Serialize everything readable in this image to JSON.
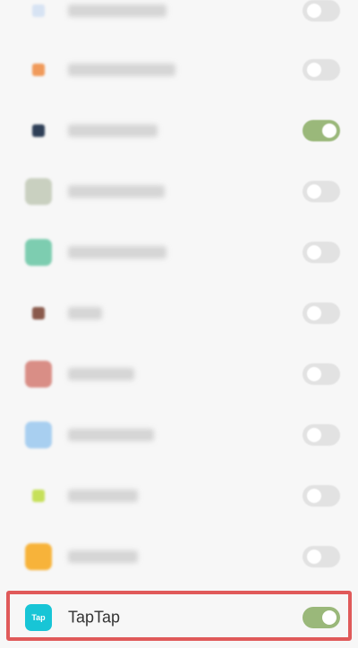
{
  "apps": [
    {
      "name": "",
      "enabled": false,
      "icon_color": "#d7e3f3",
      "icon_small": true
    },
    {
      "name": "",
      "enabled": false,
      "icon_color": "#f09a5b",
      "icon_small": true
    },
    {
      "name": "",
      "enabled": true,
      "icon_color": "#2e3f57",
      "icon_small": true
    },
    {
      "name": "",
      "enabled": false,
      "icon_color": "#c9d0c0",
      "icon_small": false
    },
    {
      "name": "",
      "enabled": false,
      "icon_color": "#7dcdb0",
      "icon_small": false
    },
    {
      "name": "",
      "enabled": false,
      "icon_color": "#8a5a4c",
      "icon_small": true
    },
    {
      "name": "",
      "enabled": false,
      "icon_color": "#d98e86",
      "icon_small": false
    },
    {
      "name": "",
      "enabled": false,
      "icon_color": "#a8cff0",
      "icon_small": false
    },
    {
      "name": "",
      "enabled": false,
      "icon_color": "#c6e05a",
      "icon_small": true
    },
    {
      "name": "",
      "enabled": false,
      "icon_color": "#f7b33a",
      "icon_small": false
    },
    {
      "name": "TapTap",
      "enabled": true,
      "icon_color": "#18c5d6",
      "icon_small": false,
      "icon_text": "Tap",
      "highlighted": true
    }
  ],
  "colors": {
    "toggle_on": "#9ab87a",
    "toggle_off": "#e2e2e2",
    "highlight_border": "#e05a5a"
  }
}
